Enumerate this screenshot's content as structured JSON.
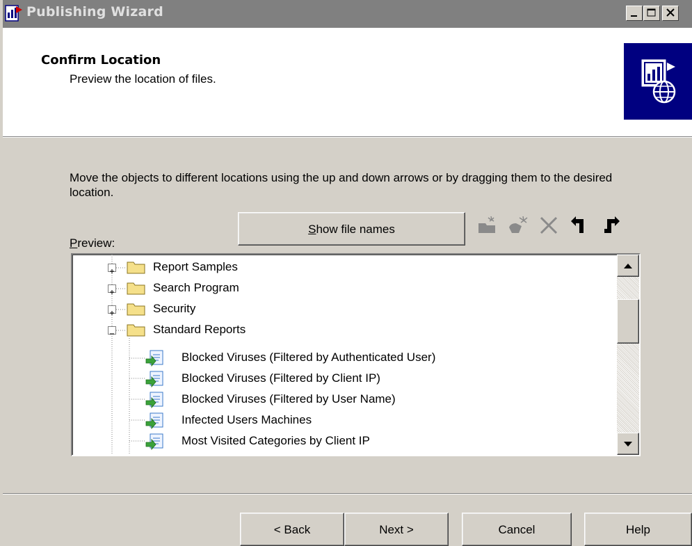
{
  "window": {
    "title": "Publishing Wizard",
    "app_icon": "publishing-wizard-icon",
    "controls": [
      "minimize-icon",
      "maximize-icon",
      "close-icon"
    ]
  },
  "header": {
    "title": "Confirm Location",
    "subtitle": "Preview the location of files.",
    "graphic": "report-globe-icon"
  },
  "main": {
    "instruction": "Move the objects to different locations using the up and down arrows or by dragging them to the desired location.",
    "preview_label": "Preview:",
    "preview_label_access_key": "P",
    "show_file_names_label": "Show file names",
    "show_file_names_access_key": "S",
    "toolbar_icons": [
      "new-folder-icon",
      "new-item-icon",
      "delete-icon",
      "move-up-icon",
      "move-down-icon"
    ]
  },
  "tree": {
    "items": [
      {
        "label": "Report Samples",
        "type": "folder",
        "expander": "+"
      },
      {
        "label": "Search Program",
        "type": "folder",
        "expander": "+"
      },
      {
        "label": "Security",
        "type": "folder",
        "expander": "+"
      },
      {
        "label": "Standard Reports",
        "type": "folder",
        "expander": "-"
      },
      {
        "label": "Blocked Viruses (Filtered by Authenticated User)",
        "type": "report"
      },
      {
        "label": "Blocked Viruses (Filtered by Client IP)",
        "type": "report"
      },
      {
        "label": "Blocked Viruses (Filtered by User Name)",
        "type": "report"
      },
      {
        "label": "Infected Users Machines",
        "type": "report"
      },
      {
        "label": "Most Visited Categories by Client IP",
        "type": "report"
      }
    ]
  },
  "footer": {
    "back_label": "< Back",
    "next_label": "Next >",
    "cancel_label": "Cancel",
    "help_label": "Help"
  },
  "colors": {
    "dialog_face": "#d4d0c8",
    "inactive_titlebar": "#808080",
    "header_graphic_bg": "#000080",
    "folder": "#f5e08a",
    "report_icon": "#3a78c8"
  }
}
